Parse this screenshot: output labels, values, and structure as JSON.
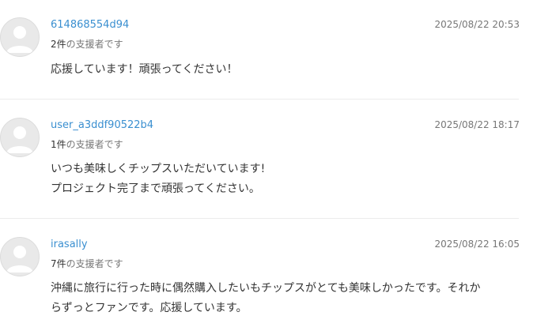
{
  "comments": [
    {
      "username": "614868554d94",
      "supporter_count": "2件",
      "supporter_suffix": "の支援者です",
      "timestamp": "2025/08/22 20:53",
      "lines": [
        "応援しています！頑張ってください！"
      ]
    },
    {
      "username": "user_a3ddf90522b4",
      "supporter_count": "1件",
      "supporter_suffix": "の支援者です",
      "timestamp": "2025/08/22 18:17",
      "lines": [
        "いつも美味しくチップスいただいています!",
        "プロジェクト完了まで頑張ってください。"
      ]
    },
    {
      "username": "irasally",
      "supporter_count": "7件",
      "supporter_suffix": "の支援者です",
      "timestamp": "2025/08/22 16:05",
      "lines": [
        "沖縄に旅行に行った時に偶然購入したいもチップスがとても美味しかったです。それか",
        "らずっとファンです。応援しています。"
      ]
    }
  ],
  "colors": {
    "username": "#3a8fd0",
    "muted": "#777777",
    "text": "#333333",
    "avatar_bg": "#e9e9e9",
    "avatar_fg": "#ffffff",
    "divider": "#ececec"
  },
  "icons": {
    "avatar": "default-user-avatar-icon"
  }
}
